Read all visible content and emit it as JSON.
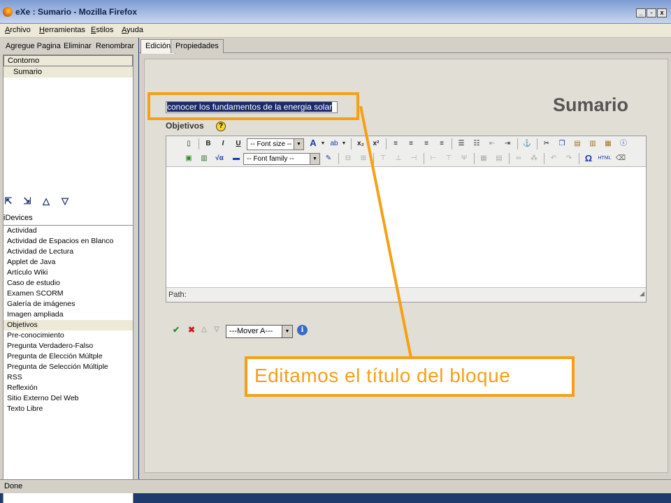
{
  "window": {
    "title": "eXe : Sumario - Mozilla Firefox",
    "buttons": [
      "_",
      "▫",
      "x"
    ]
  },
  "menu": [
    "Archivo",
    "Herramientas",
    "Estilos",
    "Ayuda"
  ],
  "outline": {
    "toolbar": [
      "Agregue Pagina",
      "Eliminar",
      "Renombrar"
    ],
    "header": "Contorno",
    "items": [
      "Sumario"
    ]
  },
  "idevices": {
    "label": "iDevices",
    "items": [
      "Actividad",
      "Actividad de Espacios en Blanco",
      "Actividad de Lectura",
      "Applet de Java",
      "Artículo Wiki",
      "Caso de estudio",
      "Examen SCORM",
      "Galería de imágenes",
      "Imagen ampliada",
      "Objetivos",
      "Pre-conocimiento",
      "Pregunta Verdadero-Falso",
      "Pregunta de Elección Múltple",
      "Pregunta de Selección Múltiple",
      "RSS",
      "Reflexión",
      "Sitio Externo Del Web",
      "Texto Libre"
    ],
    "selected_index": 9
  },
  "tabs": [
    "Edición",
    "Propiedades"
  ],
  "page": {
    "heading": "Sumario",
    "title_value": "conocer los fundamentos de la energia solar",
    "section_label": "Objetivos",
    "help_glyph": "?"
  },
  "editor": {
    "font_size_placeholder": "-- Font size --",
    "font_family_placeholder": "-- Font family --",
    "path_label": "Path:"
  },
  "actions": {
    "mover_label": "---Mover A---"
  },
  "status": "Done",
  "annotation": {
    "text": "Editamos el título del bloque",
    "color": "#f5a016"
  }
}
